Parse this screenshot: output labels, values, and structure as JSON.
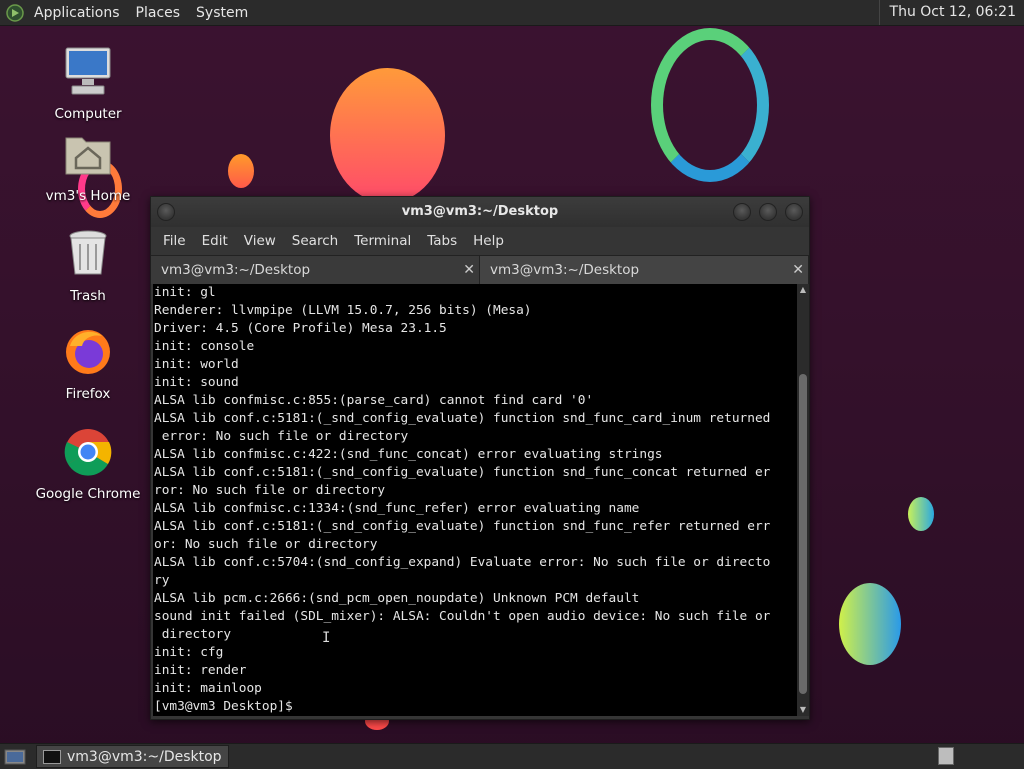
{
  "top_panel": {
    "menus": [
      "Applications",
      "Places",
      "System"
    ],
    "clock": "Thu Oct 12, 06:21"
  },
  "desktop_icons": [
    {
      "label": "Computer"
    },
    {
      "label": "vm3's Home"
    },
    {
      "label": "Trash"
    },
    {
      "label": "Firefox"
    },
    {
      "label": "Google Chrome"
    }
  ],
  "terminal": {
    "title": "vm3@vm3:~/Desktop",
    "menu": [
      "File",
      "Edit",
      "View",
      "Search",
      "Terminal",
      "Tabs",
      "Help"
    ],
    "tabs": [
      {
        "label": "vm3@vm3:~/Desktop",
        "close": "✕"
      },
      {
        "label": "vm3@vm3:~/Desktop",
        "close": "✕"
      }
    ],
    "lines": [
      "init: gl",
      "Renderer: llvmpipe (LLVM 15.0.7, 256 bits) (Mesa)",
      "Driver: 4.5 (Core Profile) Mesa 23.1.5",
      "init: console",
      "init: world",
      "init: sound",
      "ALSA lib confmisc.c:855:(parse_card) cannot find card '0'",
      "ALSA lib conf.c:5181:(_snd_config_evaluate) function snd_func_card_inum returned",
      " error: No such file or directory",
      "ALSA lib confmisc.c:422:(snd_func_concat) error evaluating strings",
      "ALSA lib conf.c:5181:(_snd_config_evaluate) function snd_func_concat returned er",
      "ror: No such file or directory",
      "ALSA lib confmisc.c:1334:(snd_func_refer) error evaluating name",
      "ALSA lib conf.c:5181:(_snd_config_evaluate) function snd_func_refer returned err",
      "or: No such file or directory",
      "ALSA lib conf.c:5704:(snd_config_expand) Evaluate error: No such file or directo",
      "ry",
      "ALSA lib pcm.c:2666:(snd_pcm_open_noupdate) Unknown PCM default",
      "sound init failed (SDL_mixer): ALSA: Couldn't open audio device: No such file or",
      " directory",
      "init: cfg",
      "init: render",
      "init: mainloop",
      "[vm3@vm3 Desktop]$ "
    ]
  },
  "taskbar": {
    "window_button": "vm3@vm3:~/Desktop"
  },
  "colors": {
    "background": "#34112b",
    "panel": "#2b2b2b",
    "terminal_bg": "#000000",
    "terminal_fg": "#e6e6e6"
  }
}
